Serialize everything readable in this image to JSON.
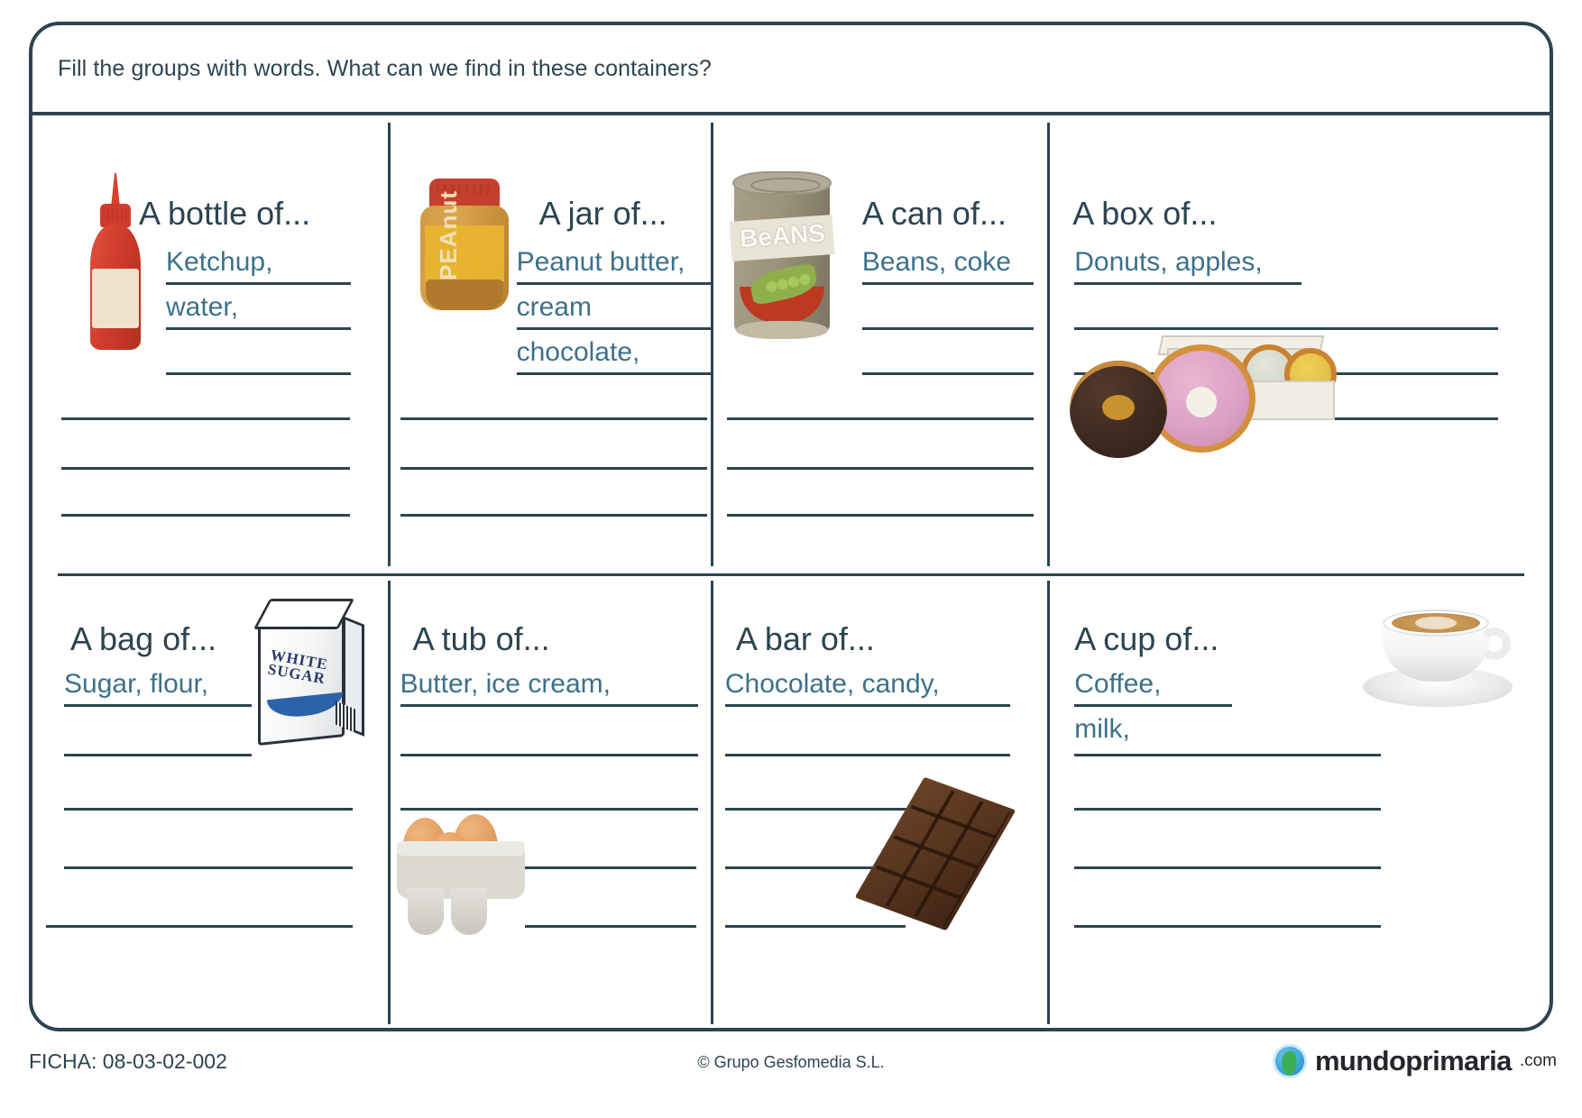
{
  "worksheet": {
    "instruction": "Fill the groups with words. What can we find in these containers?",
    "ficha": "FICHA: 08-03-02-002",
    "copyright": "© Grupo Gesfomedia S.L.",
    "brand": {
      "name": "mundoprimaria",
      "tld": ".com"
    },
    "colors": {
      "frame": "#2c4450",
      "heading_text": "#2c4450",
      "answer_text": "#3d7189",
      "line": "#2c4450"
    }
  },
  "cells": [
    {
      "id": "bottle",
      "title": "A bottle of...",
      "illustration": "ketchup-bottle-icon",
      "answers": [
        "Ketchup,",
        "water,",
        "",
        "",
        "",
        ""
      ]
    },
    {
      "id": "jar",
      "title": "A jar of...",
      "illustration": "peanut-butter-jar-icon",
      "answers": [
        "Peanut butter,",
        "cream",
        "chocolate,",
        "",
        "",
        ""
      ]
    },
    {
      "id": "can",
      "title": "A can of...",
      "illustration": "beans-can-icon",
      "answers": [
        "Beans, coke",
        "",
        "",
        "",
        "",
        ""
      ]
    },
    {
      "id": "box",
      "title": "A box of...",
      "illustration": "donut-box-icon",
      "answers": [
        "Donuts, apples,",
        "",
        "",
        "",
        "",
        ""
      ]
    },
    {
      "id": "bag",
      "title": "A bag of...",
      "illustration": "sugar-bag-icon",
      "answers": [
        "Sugar, flour,",
        "",
        "",
        "",
        ""
      ]
    },
    {
      "id": "tub",
      "title": "A tub of...",
      "illustration": "egg-carton-icon",
      "answers": [
        "Butter, ice cream,",
        "",
        "",
        "",
        ""
      ]
    },
    {
      "id": "bar",
      "title": "A bar of...",
      "illustration": "chocolate-bar-icon",
      "answers": [
        "Chocolate, candy,",
        "",
        "",
        "",
        ""
      ]
    },
    {
      "id": "cup",
      "title": "A cup of...",
      "illustration": "coffee-cup-icon",
      "answers": [
        "Coffee,",
        "milk,",
        "",
        "",
        ""
      ]
    }
  ],
  "illustration_labels": {
    "peanut_jar": "PEAnut",
    "beans_can": "BeANS",
    "sugar_bag_line1": "WHITE",
    "sugar_bag_line2": "SUGAR"
  }
}
